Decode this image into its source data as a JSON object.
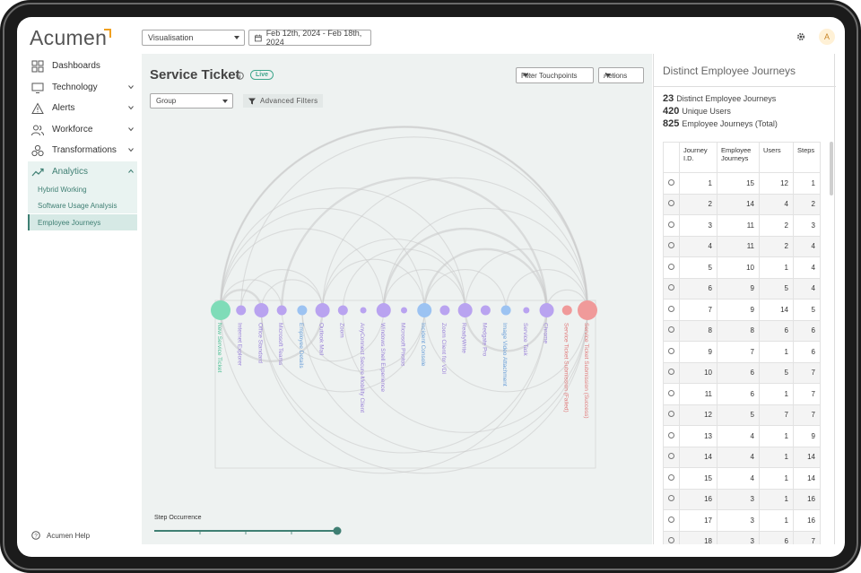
{
  "app": {
    "logo": "Acumen",
    "avatar_initial": "A"
  },
  "toolbar": {
    "view_select": "Visualisation",
    "date_range": "Feb 12th, 2024 - Feb 18th, 2024"
  },
  "sidebar": {
    "items": [
      {
        "label": "Dashboards",
        "icon": "dashboard-icon"
      },
      {
        "label": "Technology",
        "icon": "monitor-icon"
      },
      {
        "label": "Alerts",
        "icon": "alert-icon"
      },
      {
        "label": "Workforce",
        "icon": "users-icon"
      },
      {
        "label": "Transformations",
        "icon": "cubes-icon"
      },
      {
        "label": "Analytics",
        "icon": "trend-icon"
      }
    ],
    "analytics_sub": [
      "Hybrid Working",
      "Software Usage Analysis",
      "Employee Journeys"
    ],
    "help": "Acumen Help"
  },
  "main": {
    "title": "Service Ticket",
    "live_badge": "Live",
    "filter_touchpoints": "Filter Touchpoints",
    "actions": "Actions",
    "group_select": "Group",
    "advanced_filters": "Advanced Filters",
    "step_occurrence": "Step Occurrence",
    "step_occurrence_value": 1.0,
    "nodes": [
      {
        "label": "New Service Ticket",
        "size": "large",
        "color": "#7fdcb8"
      },
      {
        "label": "Internet Explorer",
        "size": "small",
        "color": "#b9a3f0"
      },
      {
        "label": "Office Standard",
        "size": "medium",
        "color": "#b9a3f0"
      },
      {
        "label": "Microsoft Teams",
        "size": "small",
        "color": "#b9a3f0"
      },
      {
        "label": "Employee Details",
        "size": "small",
        "color": "#9cc3f2"
      },
      {
        "label": "Outlook Mail",
        "size": "medium",
        "color": "#b9a3f0"
      },
      {
        "label": "Zoom",
        "size": "small",
        "color": "#b9a3f0"
      },
      {
        "label": "AnyConnect Secure Mobility Client",
        "size": "tiny",
        "color": "#b9a3f0"
      },
      {
        "label": "Windows Shell Experience",
        "size": "medium",
        "color": "#b9a3f0"
      },
      {
        "label": "Microsoft Photos",
        "size": "tiny",
        "color": "#b9a3f0"
      },
      {
        "label": "Incident Console",
        "size": "medium",
        "color": "#9cc3f2"
      },
      {
        "label": "Zoom Client for VDI",
        "size": "small",
        "color": "#b9a3f0"
      },
      {
        "label": "ReadyWrite",
        "size": "medium",
        "color": "#b9a3f0"
      },
      {
        "label": "Medgate Pro",
        "size": "small",
        "color": "#b9a3f0"
      },
      {
        "label": "Image Video Attachment",
        "size": "small",
        "color": "#9cc3f2"
      },
      {
        "label": "Service Task",
        "size": "tiny",
        "color": "#b9a3f0"
      },
      {
        "label": "Chrome",
        "size": "medium",
        "color": "#b9a3f0"
      },
      {
        "label": "Service Ticket Submission (Failed)",
        "size": "small",
        "color": "#f09a9a"
      },
      {
        "label": "Service Ticket Submission (Success)",
        "size": "large",
        "color": "#f09a9a"
      }
    ]
  },
  "panel": {
    "title": "Distinct Employee Journeys",
    "stats": [
      {
        "value": "23",
        "label": "Distinct Employee Journeys"
      },
      {
        "value": "420",
        "label": "Unique Users"
      },
      {
        "value": "825",
        "label": "Employee Journeys (Total)"
      }
    ],
    "columns": [
      "",
      "Journey I.D.",
      "Employee Journeys",
      "Users",
      "Steps"
    ],
    "rows": [
      [
        "1",
        "15",
        "12",
        "1"
      ],
      [
        "2",
        "14",
        "4",
        "2"
      ],
      [
        "3",
        "11",
        "2",
        "3"
      ],
      [
        "4",
        "11",
        "2",
        "4"
      ],
      [
        "5",
        "10",
        "1",
        "4"
      ],
      [
        "6",
        "9",
        "5",
        "4"
      ],
      [
        "7",
        "9",
        "14",
        "5"
      ],
      [
        "8",
        "8",
        "6",
        "6"
      ],
      [
        "9",
        "7",
        "1",
        "6"
      ],
      [
        "10",
        "6",
        "5",
        "7"
      ],
      [
        "11",
        "6",
        "1",
        "7"
      ],
      [
        "12",
        "5",
        "7",
        "7"
      ],
      [
        "13",
        "4",
        "1",
        "9"
      ],
      [
        "14",
        "4",
        "1",
        "14"
      ],
      [
        "15",
        "4",
        "1",
        "14"
      ],
      [
        "16",
        "3",
        "1",
        "16"
      ],
      [
        "17",
        "3",
        "1",
        "16"
      ],
      [
        "18",
        "3",
        "6",
        "7"
      ]
    ]
  }
}
